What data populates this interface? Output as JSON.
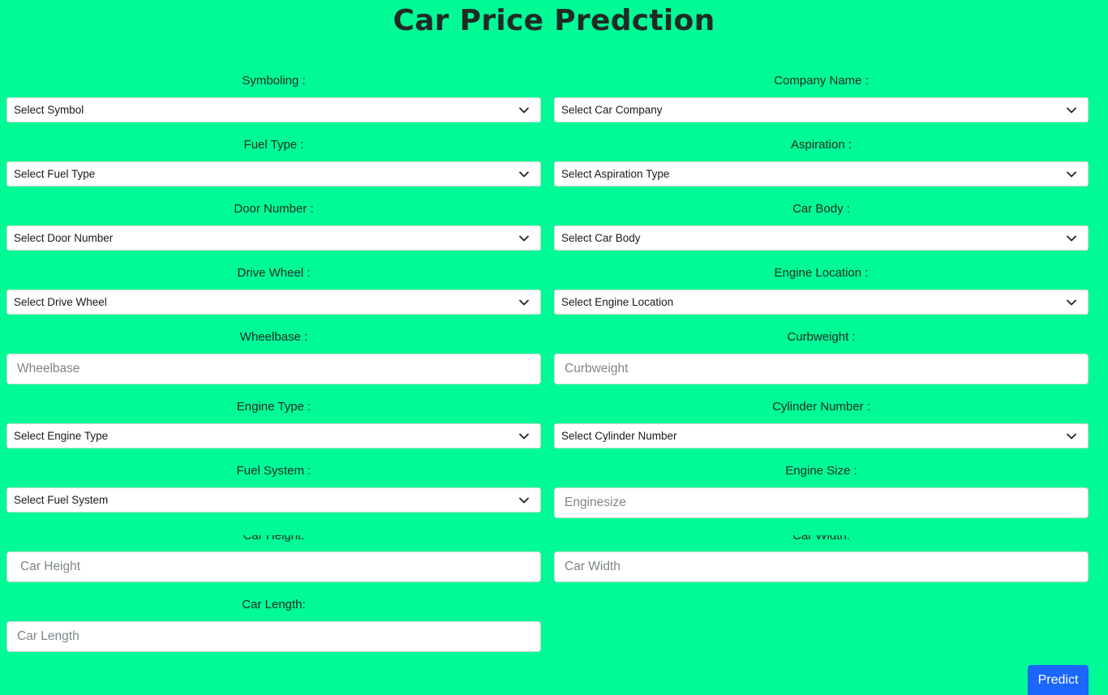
{
  "title": "Car Price Predction",
  "fields": {
    "symboling": {
      "label": "Symboling :",
      "value": "Select Symbol"
    },
    "company": {
      "label": "Company Name :",
      "value": "Select Car Company"
    },
    "fuel_type": {
      "label": "Fuel Type :",
      "value": "Select Fuel Type"
    },
    "aspiration": {
      "label": "Aspiration :",
      "value": "Select Aspiration Type"
    },
    "door_number": {
      "label": "Door Number :",
      "value": "Select Door Number"
    },
    "car_body": {
      "label": "Car Body :",
      "value": "Select Car Body"
    },
    "drive_wheel": {
      "label": "Drive Wheel :",
      "value": "Select Drive Wheel"
    },
    "engine_location": {
      "label": "Engine Location :",
      "value": "Select Engine Location"
    },
    "wheelbase": {
      "label": "Wheelbase :",
      "placeholder": "Wheelbase"
    },
    "curbweight": {
      "label": "Curbweight :",
      "placeholder": "Curbweight"
    },
    "engine_type": {
      "label": "Engine Type :",
      "value": "Select Engine Type"
    },
    "cylinder_number": {
      "label": "Cylinder Number :",
      "value": "Select Cylinder Number"
    },
    "fuel_system": {
      "label": "Fuel System :",
      "value": "Select Fuel System"
    },
    "engine_size": {
      "label": "Engine Size :",
      "placeholder": "Enginesize"
    },
    "car_height": {
      "label": "Car Height:",
      "placeholder": "Car Height"
    },
    "car_width": {
      "label": "Car Width:",
      "placeholder": "Car Width"
    },
    "car_length": {
      "label": "Car Length:",
      "placeholder": "Car Length"
    }
  },
  "predict_label": "Predict",
  "colors": {
    "background": "#00fa96",
    "button": "#1a66ff"
  },
  "icons": {
    "select_arrow": "chevron-down-icon"
  }
}
